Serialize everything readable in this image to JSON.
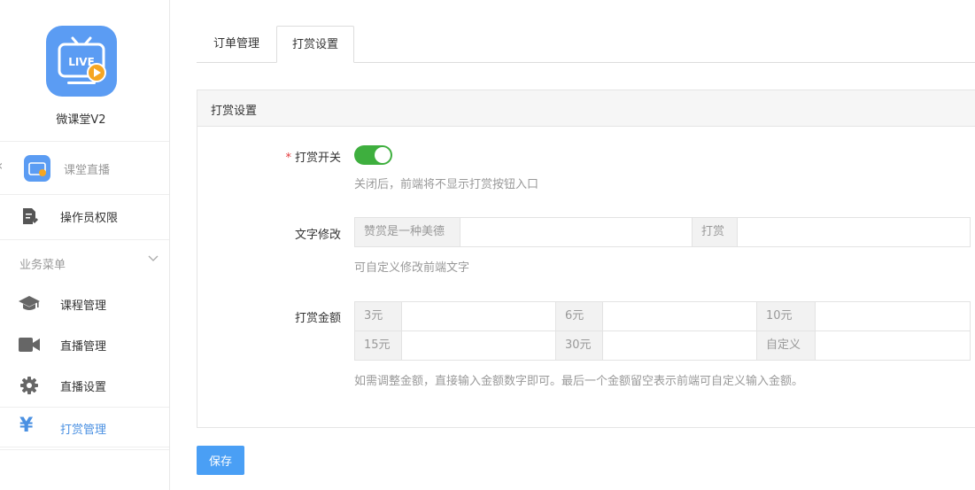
{
  "sidebar": {
    "app_name": "微课堂V2",
    "logo_text": "LIVE",
    "app_entry": "课堂直播",
    "permissions": "操作员权限",
    "group_title": "业务菜单",
    "items": [
      {
        "label": "课程管理",
        "icon": "mortarboard-icon"
      },
      {
        "label": "直播管理",
        "icon": "video-camera-icon"
      },
      {
        "label": "直播设置",
        "icon": "gear-icon"
      },
      {
        "label": "打赏管理",
        "icon": "yen-icon",
        "active": true
      }
    ],
    "accent_color": "#4a90e2"
  },
  "tabs": [
    {
      "label": "订单管理",
      "active": false
    },
    {
      "label": "打赏设置",
      "active": true
    }
  ],
  "panel": {
    "title": "打赏设置",
    "switch": {
      "label": "打赏开关",
      "required_mark": "*",
      "on": true,
      "hint": "关闭后，前端将不显示打赏按钮入口",
      "color": "#3eaf3e"
    },
    "text_edit": {
      "label": "文字修改",
      "fields": [
        {
          "addon": "赞赏是一种美德",
          "value": ""
        },
        {
          "addon": "打赏",
          "value": ""
        }
      ],
      "hint": "可自定义修改前端文字"
    },
    "amount": {
      "label": "打赏金额",
      "rows": [
        [
          {
            "addon": "3元",
            "value": ""
          },
          {
            "addon": "6元",
            "value": ""
          },
          {
            "addon": "10元",
            "value": ""
          }
        ],
        [
          {
            "addon": "15元",
            "value": ""
          },
          {
            "addon": "30元",
            "value": ""
          },
          {
            "addon": "自定义",
            "value": ""
          }
        ]
      ],
      "hint": "如需调整金额，直接输入金额数字即可。最后一个金额留空表示前端可自定义输入金额。"
    }
  },
  "save_label": "保存"
}
